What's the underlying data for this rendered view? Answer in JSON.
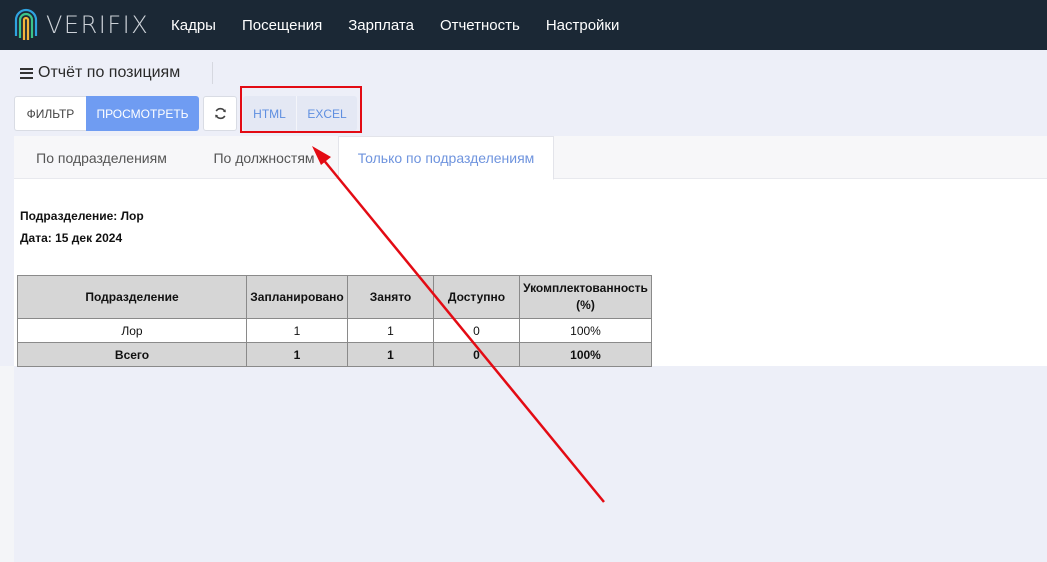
{
  "brand": {
    "name": "VERIFIX"
  },
  "nav": {
    "items": [
      "Кадры",
      "Посещения",
      "Зарплата",
      "Отчетность",
      "Настройки"
    ]
  },
  "header": {
    "title": "Отчёт по позициям",
    "filter_label": "ФИЛЬТР",
    "view_label": "ПРОСМОТРЕТЬ",
    "html_label": "HTML",
    "excel_label": "EXCEL"
  },
  "tabs": [
    "По подразделениям",
    "По должностям",
    "Только по подразделениям"
  ],
  "active_tab": 2,
  "report": {
    "division_line": "Подразделение: Лор",
    "date_line": "Дата: 15 дек 2024",
    "columns": [
      "Подразделение",
      "Запланировано",
      "Занято",
      "Доступно",
      "Укомплектованность (%)"
    ],
    "rows": [
      [
        "Лор",
        "1",
        "1",
        "0",
        "100%"
      ]
    ],
    "total": [
      "Всего",
      "1",
      "1",
      "0",
      "100%"
    ]
  },
  "colors": {
    "navbar": "#1b2835",
    "accent": "#6f9cf2",
    "annotation": "#e30b14"
  }
}
